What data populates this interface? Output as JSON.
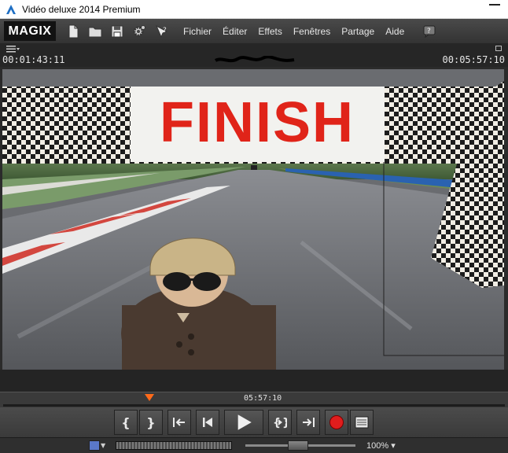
{
  "window": {
    "title": "Vidéo deluxe 2014 Premium"
  },
  "menubar": {
    "logo": "MAGIX",
    "items": [
      "Fichier",
      "Éditer",
      "Effets",
      "Fenêtres",
      "Partage",
      "Aide"
    ]
  },
  "preview": {
    "timecode_left": "00:01:43:11",
    "timecode_right": "00:05:57:10",
    "banner_text": "FINISH"
  },
  "timeline": {
    "position": "05:57:10"
  },
  "statusbar": {
    "zoom": "100%"
  },
  "icons": {
    "new": "new-document-icon",
    "open": "open-folder-icon",
    "save": "save-icon",
    "settings": "gear-icon",
    "help": "context-help-icon",
    "record": "record-icon"
  },
  "colors": {
    "accent_red": "#e02419",
    "playhead": "#ff6a1a"
  }
}
